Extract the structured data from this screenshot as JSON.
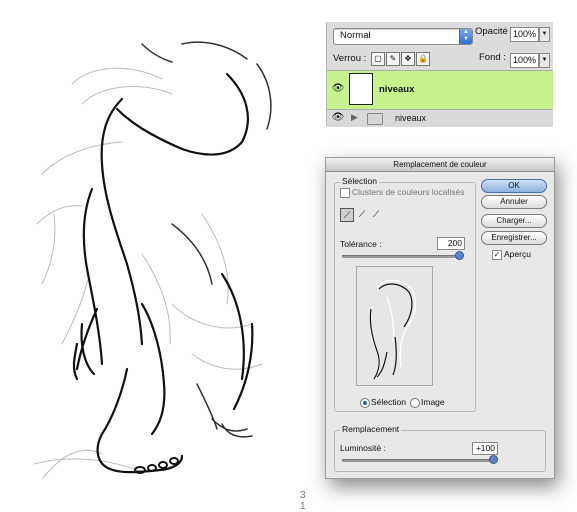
{
  "layers_panel": {
    "blend_mode": "Normal",
    "opacity_label": "Opacité :",
    "opacity_value": "100%",
    "lock_label": "Verrou :",
    "fill_label": "Fond :",
    "fill_value": "100%",
    "layers": [
      {
        "name": "niveaux",
        "type": "layer",
        "selected": true,
        "highlight_color": "#c7f28d"
      },
      {
        "name": "niveaux",
        "type": "group",
        "selected": false
      }
    ]
  },
  "dialog": {
    "title": "Remplacement de couleur",
    "selection_group": "Sélection",
    "localized_clusters_label": "Clusters de couleurs localisés",
    "localized_clusters_checked": false,
    "tolerance_label": "Tolérance :",
    "tolerance_value": "200",
    "radio_selection_label": "Sélection",
    "radio_image_label": "Image",
    "radio_selected": "Sélection",
    "replacement_group": "Remplacement",
    "luminosity_label": "Luminosité :",
    "luminosity_value": "+100",
    "buttons": {
      "ok": "OK",
      "cancel": "Annuler",
      "load": "Charger...",
      "save": "Enregistrer..."
    },
    "preview_label": "Aperçu",
    "preview_checked": true
  },
  "drawing": {
    "page_number": "3 1"
  }
}
